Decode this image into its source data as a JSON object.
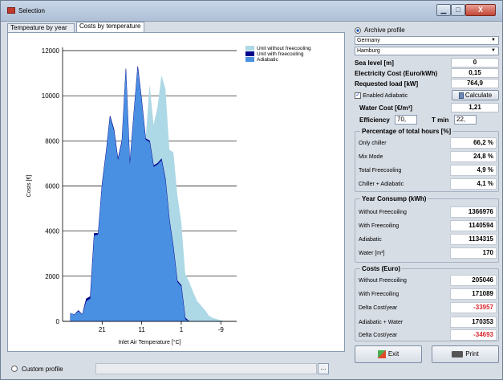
{
  "window": {
    "title": "Selection",
    "min_glyph": "▁",
    "max_glyph": "□",
    "close_glyph": "X"
  },
  "tabs": [
    "Tempeature by year",
    "Costs by temperature"
  ],
  "chart_data": {
    "type": "area",
    "ylabel": "Costs [€]",
    "xlabel": "Inlet Air Temperature [°C]",
    "ylim": [
      0,
      12000
    ],
    "yticks": [
      0,
      2000,
      4000,
      6000,
      8000,
      10000,
      12000
    ],
    "xticks": [
      "21",
      "11",
      "1",
      "-9"
    ],
    "xtick_values": [
      21,
      11,
      1,
      -9
    ],
    "xlim": [
      31,
      -13
    ],
    "legend_position": "top-right",
    "series": [
      {
        "name": "Unit without freecooling",
        "color": "#add8e6",
        "x": [
          29,
          28,
          27,
          26,
          25,
          24,
          23,
          22,
          21,
          20,
          19,
          18,
          17,
          16,
          15,
          14,
          13,
          12,
          11,
          10,
          9,
          8,
          7,
          6,
          5,
          4,
          3,
          2,
          1,
          0,
          -1,
          -2,
          -3,
          -4,
          -5,
          -6,
          -7,
          -8,
          -9,
          -10
        ],
        "values": [
          350,
          300,
          480,
          300,
          1000,
          1100,
          3900,
          3900,
          6100,
          7500,
          9100,
          8500,
          7200,
          8000,
          11200,
          7000,
          9200,
          11300,
          9800,
          8100,
          10500,
          8700,
          9500,
          10900,
          10300,
          7600,
          7500,
          5600,
          4400,
          2100,
          1750,
          1300,
          900,
          700,
          500,
          250,
          150,
          100,
          50,
          0
        ]
      },
      {
        "name": "Unit with freecooling",
        "color": "#00008b",
        "x": [
          29,
          28,
          27,
          26,
          25,
          24,
          23,
          22,
          21,
          20,
          19,
          18,
          17,
          16,
          15,
          14,
          13,
          12,
          11,
          10,
          9,
          8,
          7,
          6,
          5,
          4,
          3,
          2,
          1,
          0,
          -1,
          -2,
          -3,
          -4,
          -5,
          -6,
          -7,
          -8,
          -9,
          -10
        ],
        "values": [
          350,
          300,
          480,
          300,
          1000,
          1100,
          3900,
          3900,
          6100,
          7500,
          9100,
          8500,
          7200,
          8000,
          11200,
          7000,
          9200,
          11300,
          9800,
          8100,
          8000,
          6900,
          7000,
          7200,
          6300,
          4500,
          3300,
          1800,
          1600,
          150,
          0,
          0,
          0,
          0,
          0,
          0,
          0,
          0,
          0,
          0
        ]
      },
      {
        "name": "Adiabatic",
        "color": "#4a90e2",
        "x": [
          29,
          28,
          27,
          26,
          25,
          24,
          23,
          22,
          21,
          20,
          19,
          18,
          17,
          16,
          15,
          14,
          13,
          12,
          11,
          10,
          9,
          8,
          7,
          6,
          5,
          4,
          3,
          2,
          1,
          0,
          -1,
          -2,
          -3,
          -4,
          -5,
          -6,
          -7,
          -8,
          -9,
          -10
        ],
        "values": [
          350,
          300,
          450,
          300,
          900,
          1000,
          3800,
          3850,
          6050,
          7450,
          9050,
          8450,
          7150,
          7950,
          11150,
          6950,
          9150,
          11250,
          9750,
          8050,
          7950,
          6850,
          6950,
          7150,
          6250,
          4450,
          3250,
          1750,
          1550,
          100,
          0,
          0,
          0,
          0,
          0,
          0,
          0,
          0,
          0,
          0
        ]
      }
    ]
  },
  "bottom": {
    "custom_profile_label": "Custom profile",
    "browse_label": "..."
  },
  "right": {
    "archive_label": "Archive profile",
    "country": "Germany",
    "city": "Hamburg",
    "sea_level_label": "Sea level [m]",
    "sea_level": "0",
    "electricity_label": "Electricity Cost (Euro/kWh)",
    "electricity": "0,15",
    "load_label": "Requested load [kW]",
    "load": "764,9",
    "adiabatic_label": "Enabled Adiabatic",
    "calculate_label": "Calculate",
    "water_cost_label": "Water Cost [€/m³]",
    "water_cost": "1,21",
    "efficiency_label": "Efficiency",
    "efficiency": "70,",
    "tmin_label": "T min",
    "tmin": "22,",
    "percent": {
      "title": "Percentage of total hours [%]",
      "rows": [
        {
          "label": "Only chiller",
          "value": "66,2 %"
        },
        {
          "label": "Mix Mode",
          "value": "24,8 %"
        },
        {
          "label": "Total Freecooling",
          "value": "4,9 %"
        },
        {
          "label": "Chiller + Adiabatic",
          "value": "4,1 %"
        }
      ]
    },
    "consump": {
      "title": "Year Consump (kWh)",
      "rows": [
        {
          "label": "Without Freecoiling",
          "value": "1366976"
        },
        {
          "label": "With Freecoiling",
          "value": "1140594"
        },
        {
          "label": "Adiabatic",
          "value": "1134315"
        },
        {
          "label": "Water [m³]",
          "value": "170"
        }
      ]
    },
    "costs": {
      "title": "Costs (Euro)",
      "rows": [
        {
          "label": "Without Freecoiling",
          "value": "205046",
          "neg": false
        },
        {
          "label": "With Freecoiling",
          "value": "171089",
          "neg": false
        },
        {
          "label": "Delta Cost/year",
          "value": "-33957",
          "neg": true
        },
        {
          "label": "Adiabatic + Water",
          "value": "170353",
          "neg": false
        },
        {
          "label": "Delta Cost/year",
          "value": "-34693",
          "neg": true
        }
      ]
    },
    "exit_label": "Exit",
    "print_label": "Print"
  }
}
